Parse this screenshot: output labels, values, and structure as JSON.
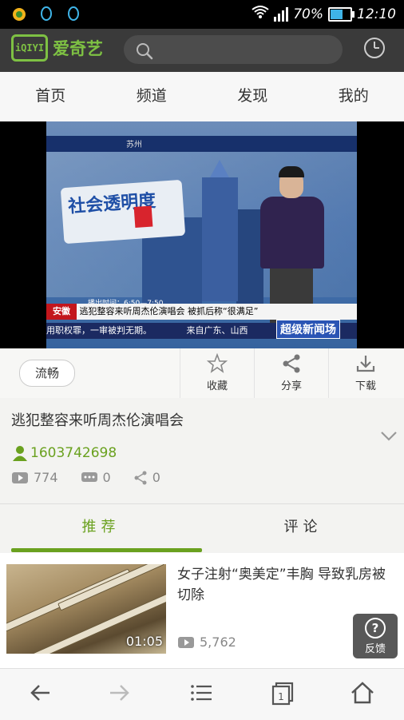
{
  "status_bar": {
    "battery_percent": "70%",
    "battery_level": 0.7,
    "time": "12:10"
  },
  "header": {
    "logo_letters": "iQIYI",
    "brand": "爱奇艺"
  },
  "nav_tabs": [
    "首页",
    "频道",
    "发现",
    "我的"
  ],
  "video": {
    "overlay": {
      "show_logo": "社会透明度",
      "city": "苏州",
      "time_slot": "播出时间：6:50—7:50",
      "province_tag": "安徽",
      "headline": "逃犯整容来听周杰伦演唱会  被抓后称“很满足”",
      "ticker": "用职权罪，一审被判无期。",
      "ticker_right": "来自广东、山西",
      "program_badge": "超级新闻场"
    }
  },
  "actions": {
    "quality": "流畅",
    "items": [
      {
        "name": "favorite",
        "label": "收藏"
      },
      {
        "name": "share",
        "label": "分享"
      },
      {
        "name": "download",
        "label": "下载"
      }
    ]
  },
  "info": {
    "title": "逃犯整容来听周杰伦演唱会",
    "uploader": "1603742698",
    "plays": "774",
    "comments": "0",
    "shares": "0"
  },
  "sub_tabs": {
    "recommend": "推荐",
    "comments": "评论"
  },
  "recommendation": {
    "title": "女子注射“奥美定”丰胸 导致乳房被切除",
    "duration": "01:05",
    "views": "5,762"
  },
  "feedback": {
    "icon": "?",
    "label": "反馈"
  },
  "colors": {
    "accent": "#6aa11f",
    "brand_green": "#7ec143",
    "topbar": "#3a3a3a"
  }
}
